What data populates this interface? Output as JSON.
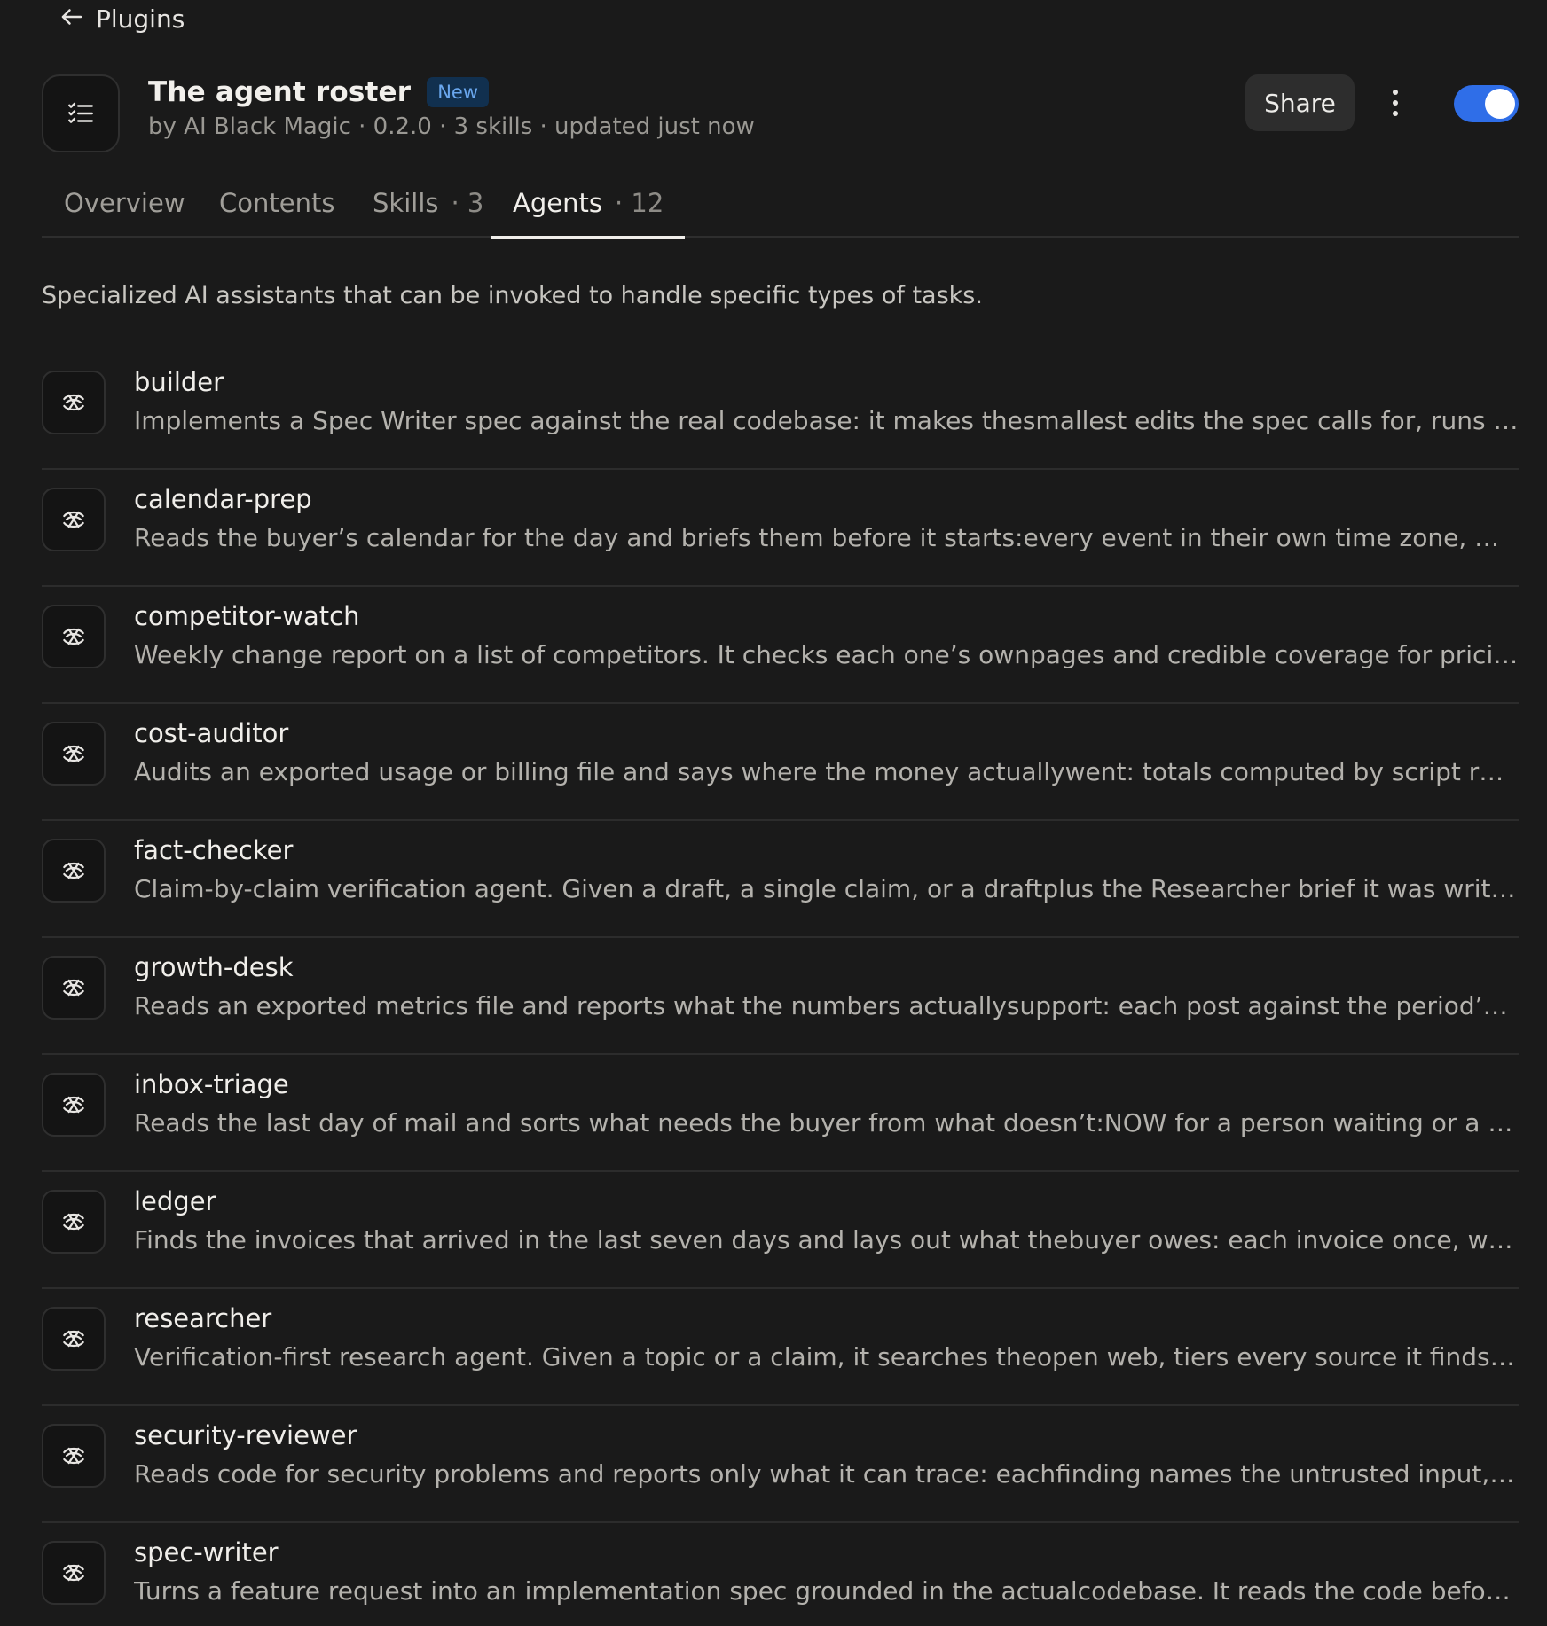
{
  "nav": {
    "back_label": "Plugins"
  },
  "plugin": {
    "icon": "checklist-icon",
    "title": "The agent roster",
    "badge": "New",
    "meta": "by AI Black Magic · 0.2.0 · 3 skills · updated just now",
    "enabled": true
  },
  "actions": {
    "share_label": "Share"
  },
  "tabs": [
    {
      "label": "Overview",
      "count": ""
    },
    {
      "label": "Contents",
      "count": ""
    },
    {
      "label": "Skills",
      "count": "· 3"
    },
    {
      "label": "Agents",
      "count": "· 12",
      "active": true
    }
  ],
  "intro": "Specialized AI assistants that can be invoked to handle specific types of tasks.",
  "agents": [
    {
      "name": "builder",
      "description": "Implements a Spec Writer spec against the real codebase: it makes thesmallest edits the spec calls for, runs the repo’s tests and reports what changed."
    },
    {
      "name": "calendar-prep",
      "description": "Reads the buyer’s calendar for the day and briefs them before it starts:every event in their own time zone, what each one is for and what to bring."
    },
    {
      "name": "competitor-watch",
      "description": "Weekly change report on a list of competitors. It checks each one’s ownpages and credible coverage for pricing, product and positioning changes."
    },
    {
      "name": "cost-auditor",
      "description": "Audits an exported usage or billing file and says where the money actuallywent: totals computed by script rather than estimated by eye."
    },
    {
      "name": "fact-checker",
      "description": "Claim-by-claim verification agent. Given a draft, a single claim, or a draftplus the Researcher brief it was written from, it checks every claim."
    },
    {
      "name": "growth-desk",
      "description": "Reads an exported metrics file and reports what the numbers actuallysupport: each post against the period’s median reach and engagement."
    },
    {
      "name": "inbox-triage",
      "description": "Reads the last day of mail and sorts what needs the buyer from what doesn’t:NOW for a person waiting or a stated deadline, LATER for the rest."
    },
    {
      "name": "ledger",
      "description": "Finds the invoices that arrived in the last seven days and lays out what thebuyer owes: each invoice once, with vendor, amount and due date."
    },
    {
      "name": "researcher",
      "description": "Verification-first research agent. Given a topic or a claim, it searches theopen web, tiers every source it finds, and returns a cited brief."
    },
    {
      "name": "security-reviewer",
      "description": "Reads code for security problems and reports only what it can trace: eachfinding names the untrusted input, the dangerous sink and the path between."
    },
    {
      "name": "spec-writer",
      "description": "Turns a feature request into an implementation spec grounded in the actualcodebase. It reads the code before it plans anything."
    }
  ],
  "agent_icon": "agent-icon"
}
